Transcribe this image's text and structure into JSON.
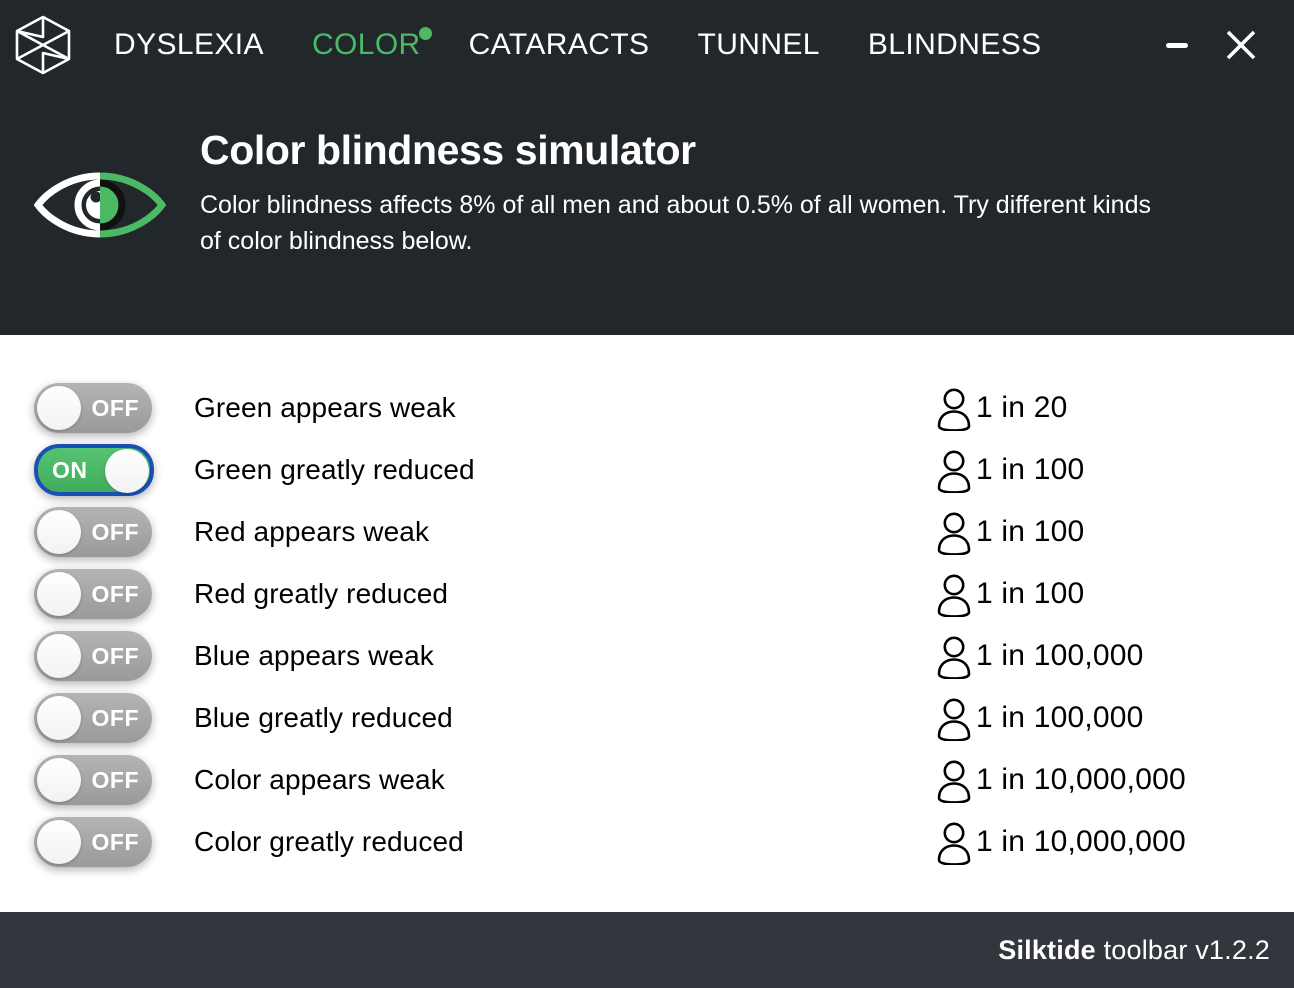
{
  "window": {
    "logo_icon": "silktide-hex-logo-icon",
    "minimize_label": "minimize-icon",
    "close_label": "close-icon"
  },
  "nav": {
    "items": [
      {
        "label": "DYSLEXIA",
        "active": false,
        "dot": false
      },
      {
        "label": "COLOR",
        "active": true,
        "dot": true
      },
      {
        "label": "CATARACTS",
        "active": false,
        "dot": false
      },
      {
        "label": "TUNNEL",
        "active": false,
        "dot": false
      },
      {
        "label": "BLINDNESS",
        "active": false,
        "dot": false
      }
    ],
    "active_color": "#4cb964"
  },
  "banner": {
    "icon": "eye-icon",
    "title": "Color blindness simulator",
    "description": "Color blindness affects 8% of all men and about 0.5% of all women. Try different kinds of color blindness below."
  },
  "simulations": [
    {
      "label": "Green appears weak",
      "state": "OFF",
      "on": false,
      "prevalence": "1 in 20"
    },
    {
      "label": "Green greatly reduced",
      "state": "ON",
      "on": true,
      "prevalence": "1 in 100"
    },
    {
      "label": "Red appears weak",
      "state": "OFF",
      "on": false,
      "prevalence": "1 in 100"
    },
    {
      "label": "Red greatly reduced",
      "state": "OFF",
      "on": false,
      "prevalence": "1 in 100"
    },
    {
      "label": "Blue appears weak",
      "state": "OFF",
      "on": false,
      "prevalence": "1 in 100,000"
    },
    {
      "label": "Blue greatly reduced",
      "state": "OFF",
      "on": false,
      "prevalence": "1 in 100,000"
    },
    {
      "label": "Color appears weak",
      "state": "OFF",
      "on": false,
      "prevalence": "1 in 10,000,000"
    },
    {
      "label": "Color greatly reduced",
      "state": "OFF",
      "on": false,
      "prevalence": "1 in 10,000,000"
    }
  ],
  "footer": {
    "brand": "Silktide",
    "rest": " toolbar v1.2.2"
  },
  "colors": {
    "header_bg": "#22272b",
    "footer_bg": "#33373d",
    "accent_green": "#4cb964",
    "toggle_on_green": "#4cb964",
    "focus_blue": "#1b4fb5",
    "toggle_off_gray": "#a0a0a0"
  }
}
